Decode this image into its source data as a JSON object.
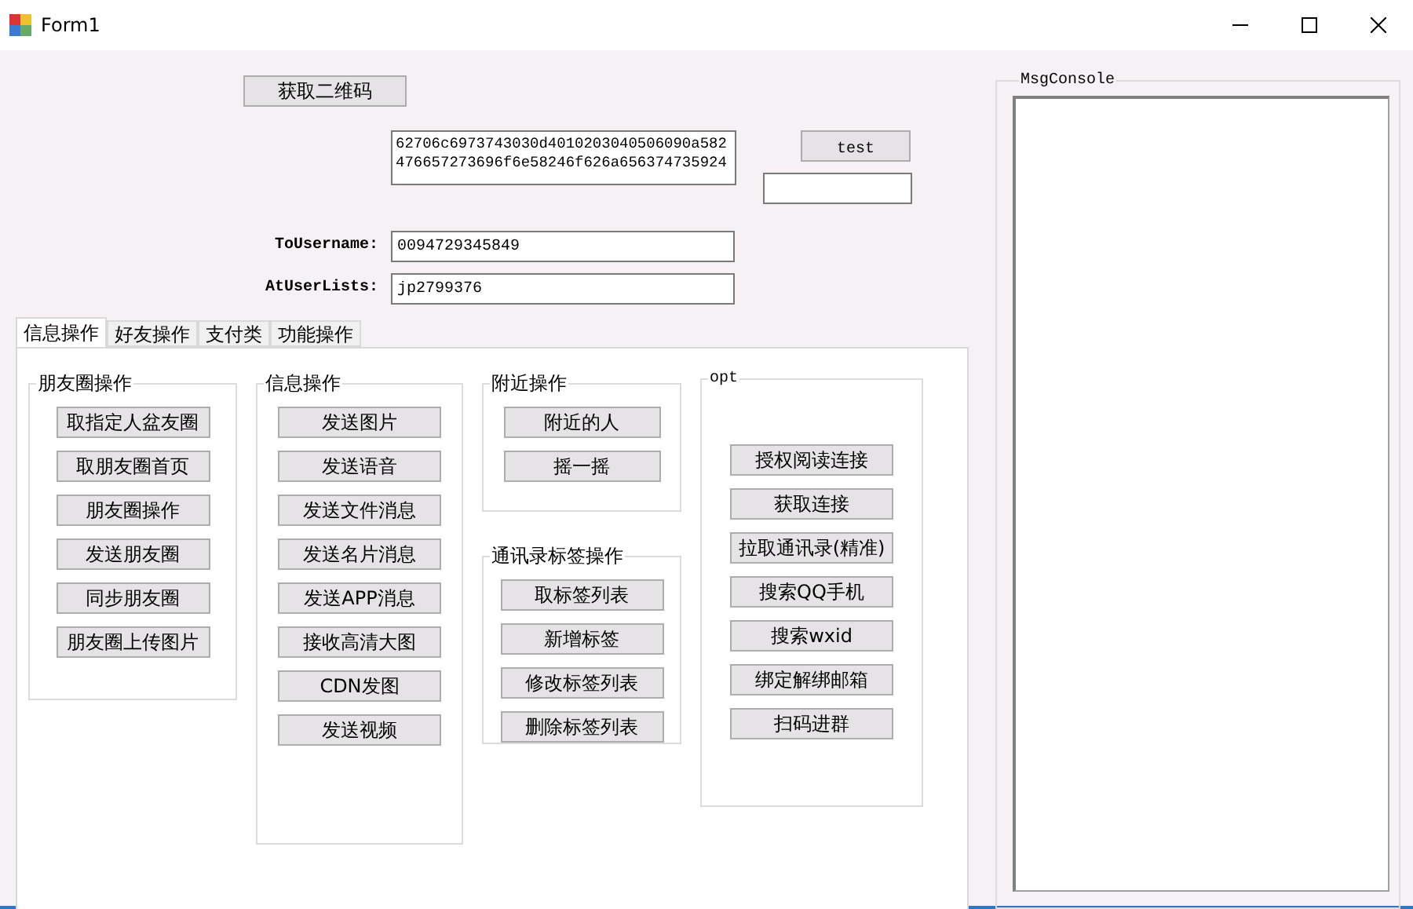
{
  "window": {
    "title": "Form1"
  },
  "qr_button": "获取二维码",
  "token_field": {
    "value": "62706c6973743030d4010203040506090a582476657273696f6e58246f626a656374735924"
  },
  "test_button": "test",
  "to_username": {
    "label": "ToUsername:",
    "value": "0094729345849"
  },
  "at_user_lists": {
    "label": "AtUserLists:",
    "value": "jp2799376"
  },
  "tabs": [
    {
      "label": "信息操作",
      "selected": true
    },
    {
      "label": "好友操作",
      "selected": false
    },
    {
      "label": "支付类",
      "selected": false
    },
    {
      "label": "功能操作",
      "selected": false
    }
  ],
  "groups": [
    {
      "title": "朋友圈操作",
      "buttons": [
        "取指定人盆友圈",
        "取朋友圈首页",
        "朋友圈操作",
        "发送朋友圈",
        "同步朋友圈",
        "朋友圈上传图片"
      ]
    },
    {
      "title": "信息操作",
      "buttons": [
        "发送图片",
        "发送语音",
        "发送文件消息",
        "发送名片消息",
        "发送APP消息",
        "接收高清大图",
        "CDN发图",
        "发送视频"
      ]
    },
    {
      "title": "附近操作",
      "buttons": [
        "附近的人",
        "摇一摇"
      ]
    },
    {
      "title": "通讯录标签操作",
      "buttons": [
        "取标签列表",
        "新增标签",
        "修改标签列表",
        "删除标签列表"
      ]
    },
    {
      "title": "opt",
      "buttons": [
        "授权阅读连接",
        "获取连接",
        "拉取通讯录(精准)",
        "搜索QQ手机",
        "搜索wxid",
        "绑定解绑邮箱",
        "扫码进群"
      ]
    }
  ],
  "console": {
    "title": "MsgConsole"
  }
}
